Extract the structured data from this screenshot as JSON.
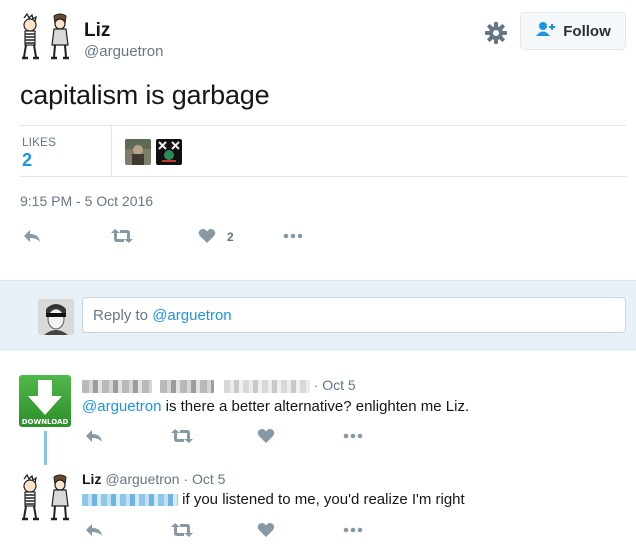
{
  "tweet": {
    "display_name": "Liz",
    "screen_name": "@arguetron",
    "follow_label": "Follow",
    "text": "capitalism is garbage",
    "likes_label": "LIKES",
    "likes_count": "2",
    "timestamp": "9:15 PM - 5 Oct 2016",
    "like_action_count": "2",
    "icons": [
      "gear-icon",
      "follow-person-icon",
      "reply-icon",
      "retweet-icon",
      "heart-icon",
      "more-icon"
    ]
  },
  "reply_box": {
    "prefix": "Reply to",
    "mention": "@arguetron"
  },
  "replies": [
    {
      "date_sep": "·",
      "date": "Oct 5",
      "avatar_label": "DOWNLOAD",
      "mention": "@arguetron",
      "text": " is there a better alternative? enlighten me Liz."
    },
    {
      "name": "Liz",
      "handle": "@arguetron",
      "date_sep": "·",
      "date": "Oct 5",
      "text": "if you listened to me, you'd realize I'm right"
    }
  ],
  "colors": {
    "link": "#1b95e0",
    "muted": "#657786",
    "text": "#14171a",
    "reply_bg": "#e8f0f8",
    "thread_line": "#86c6e0",
    "download_green": "#3aa636"
  }
}
